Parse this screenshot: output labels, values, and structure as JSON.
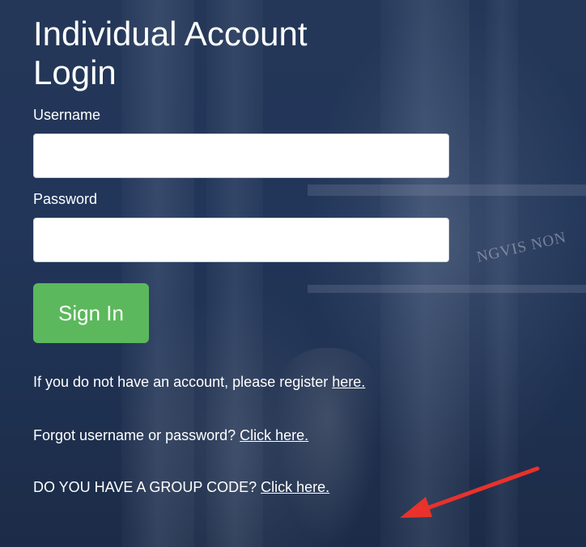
{
  "login": {
    "title": "Individual Account Login",
    "username_label": "Username",
    "username_value": "",
    "password_label": "Password",
    "password_value": "",
    "sign_in_label": "Sign In"
  },
  "links": {
    "register_prefix": "If you do not have an account, please register ",
    "register_link": "here.",
    "forgot_prefix": "Forgot username or password? ",
    "forgot_link": "Click here.",
    "group_prefix": "DO YOU HAVE A GROUP CODE? ",
    "group_link": "Click here."
  },
  "background": {
    "inscription": "NGVIS NON"
  },
  "colors": {
    "background": "#1f3150",
    "sign_in_button": "#5cb85c",
    "annotation_arrow": "#e8322b",
    "text": "#ffffff"
  }
}
